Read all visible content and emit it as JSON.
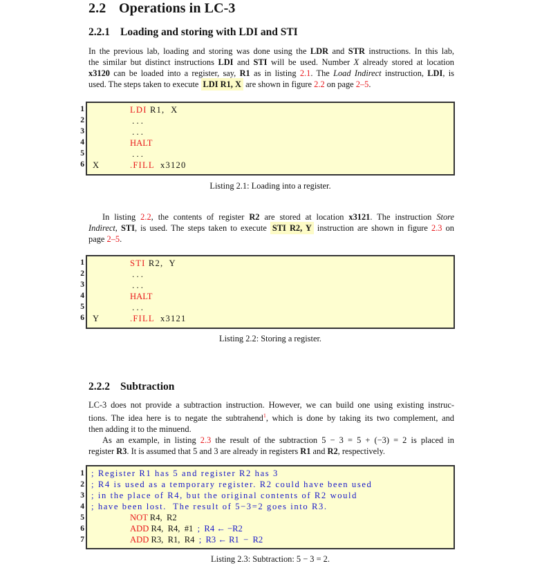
{
  "section": {
    "number": "2.2",
    "title": "Operations in LC-3"
  },
  "subsection1": {
    "number": "2.2.1",
    "title": "Loading and storing with LDI and STI"
  },
  "para1": {
    "l1": [
      "In the previous lab, loading and storing was done using the ",
      "LDR",
      " and ",
      "STR",
      " instructions. In this lab,"
    ],
    "l2": [
      "the similar but distinct instructions ",
      "LDI",
      " and ",
      "STI",
      " will be used. Number ",
      "X",
      " already stored at location"
    ],
    "l3": [
      "x3120",
      " can be loaded into a register, say, ",
      "R1",
      " as in listing ",
      "2.1",
      ". The ",
      "Load Indirect",
      " instruction, ",
      "LDI",
      ", is"
    ],
    "l4": [
      "used. The steps taken to execute ",
      "LDI R1, X",
      " are shown in figure ",
      "2.2",
      " on page ",
      "2–5",
      "."
    ]
  },
  "listing1": {
    "caption": "Listing 2.1: Loading into a register.",
    "lines": [
      {
        "num": "1",
        "label": "",
        "op": "LDI",
        "args": " R1,  X"
      },
      {
        "num": "2",
        "label": "",
        "op": "",
        "args": " . . ."
      },
      {
        "num": "3",
        "label": "",
        "op": "",
        "args": " . . ."
      },
      {
        "num": "4",
        "label": "",
        "op": "HALT",
        "args": ""
      },
      {
        "num": "5",
        "label": "",
        "op": "",
        "args": " . . ."
      },
      {
        "num": "6",
        "label": "X",
        "op": ".FILL",
        "args": "  x3120"
      }
    ]
  },
  "para2": {
    "l1": [
      "In listing ",
      "2.2",
      ", the contents of register ",
      "R2",
      " are stored at location ",
      "x3121",
      ".  The instruction ",
      "Store"
    ],
    "l2": [
      "Indirect",
      ", ",
      "STI",
      ", is used. The steps taken to execute ",
      "STI R2, Y",
      " instruction are shown in figure ",
      "2.3",
      " on"
    ],
    "l3": [
      "page ",
      "2–5",
      "."
    ]
  },
  "listing2": {
    "caption": "Listing 2.2: Storing a register.",
    "lines": [
      {
        "num": "1",
        "label": "",
        "op": "STI",
        "args": " R2,  Y"
      },
      {
        "num": "2",
        "label": "",
        "op": "",
        "args": " . . ."
      },
      {
        "num": "3",
        "label": "",
        "op": "",
        "args": " . . ."
      },
      {
        "num": "4",
        "label": "",
        "op": "HALT",
        "args": ""
      },
      {
        "num": "5",
        "label": "",
        "op": "",
        "args": " . . ."
      },
      {
        "num": "6",
        "label": "Y",
        "op": ".FILL",
        "args": "  x3121"
      }
    ]
  },
  "subsection2": {
    "number": "2.2.2",
    "title": "Subtraction"
  },
  "para3": {
    "l1": "LC-3 does not provide a subtraction instruction. However, we can build one using existing instruc-",
    "l2a": "tions. The idea here is to negate the subtrahend",
    "footnote": "1",
    "l2b": ", which is done by taking its two complement, and",
    "l3": "then adding it to the minuend."
  },
  "para4": {
    "l1": [
      "As an example, in listing ",
      "2.3",
      " the result of the subtraction 5 − 3 = 5 + (−3) = 2 is placed in"
    ],
    "l2": [
      "register ",
      "R3",
      ". It is assumed that 5 and 3 are already in registers ",
      "R1",
      " and ",
      "R2",
      ", respectively."
    ]
  },
  "listing3": {
    "caption": "Listing 2.3: Subtraction: 5 − 3 = 2.",
    "comments": [
      {
        "num": "1",
        "text": "; Register R1 has 5 and register R2 has 3"
      },
      {
        "num": "2",
        "text": "; R4 is used as a temporary register. R2 could have been used"
      },
      {
        "num": "3",
        "text": "; in the place of R4, but the original contents of R2 would"
      },
      {
        "num": "4",
        "text": "; have been lost.  The result of 5−3=2 goes into R3."
      }
    ],
    "code": [
      {
        "num": "5",
        "op": "NOT",
        "args": " R4,  R2",
        "comment": ""
      },
      {
        "num": "6",
        "op": "ADD",
        "args": " R4,  R4,  #1  ",
        "comment": ";  R4 ← −R2"
      },
      {
        "num": "7",
        "op": "ADD",
        "args": " R3,  R1,  R4  ",
        "comment": ";  R3 ← R1  −  R2"
      }
    ]
  },
  "colors": {
    "reference": "#e8161a",
    "keyword": "#e8161a",
    "comment": "#1717c9",
    "listing_bg": "#fefed0",
    "highlight_bg": "#fdfbc6"
  }
}
